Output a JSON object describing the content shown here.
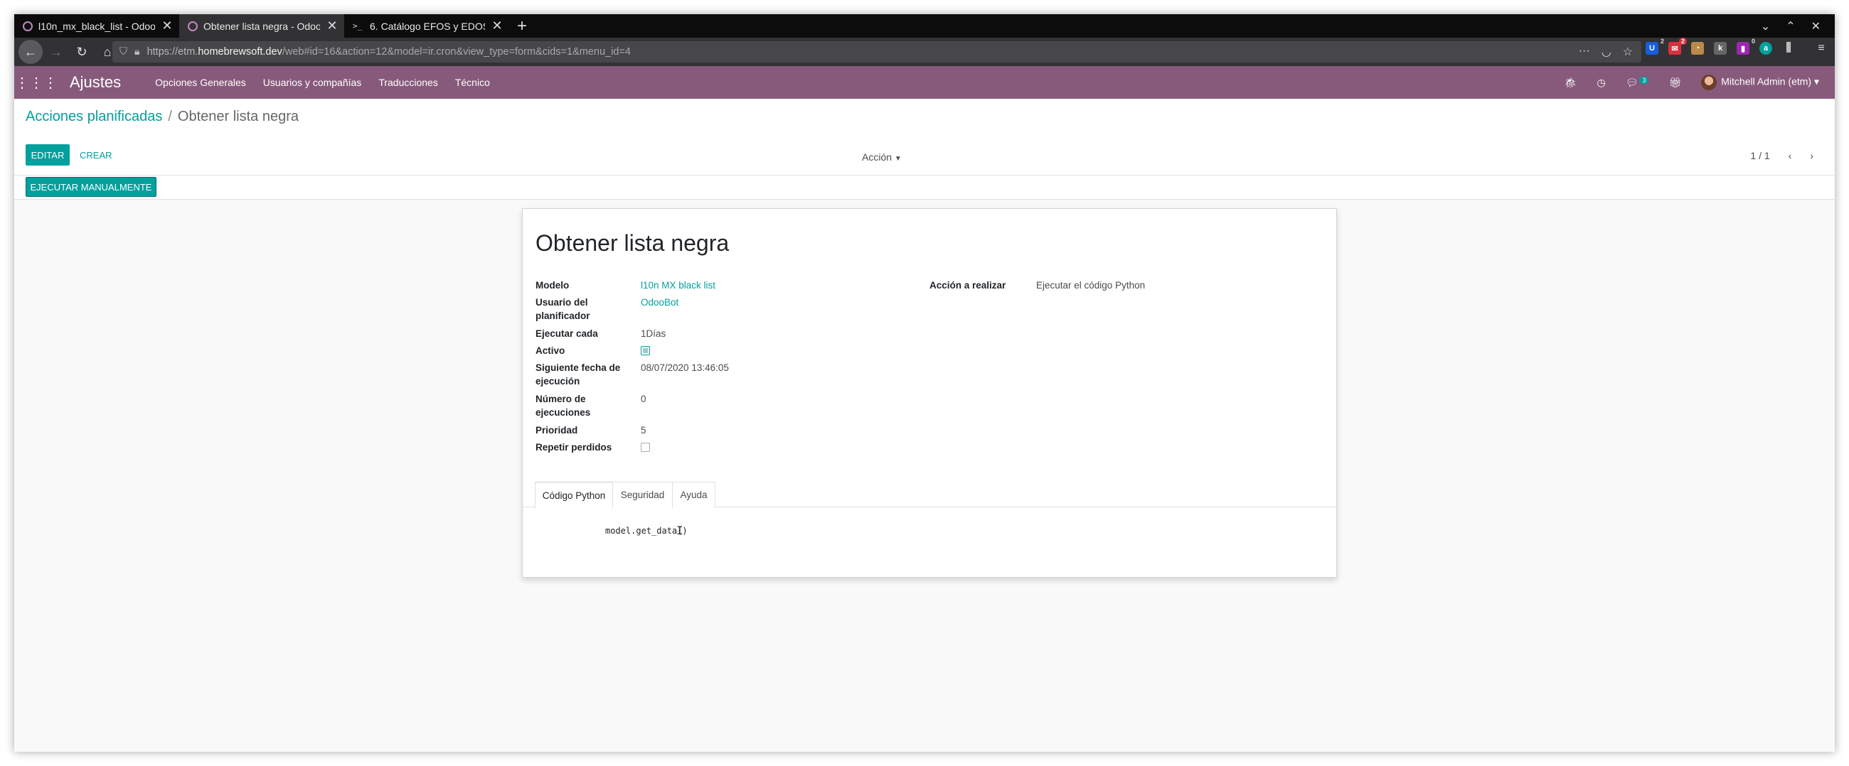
{
  "browser": {
    "tabs": [
      {
        "title": "l10n_mx_black_list - Odoo",
        "active": false,
        "icon": "odoo-favicon-icon"
      },
      {
        "title": "Obtener lista negra - Odoo",
        "active": true,
        "icon": "odoo-favicon-icon"
      },
      {
        "title": "6. Catálogo EFOS y EDOS",
        "active": false,
        "icon": "terminal-icon"
      }
    ],
    "url_prefix": "https://etm.",
    "url_host": "homebrewsoft.dev",
    "url_rest": "/web#id=16&action=12&model=ir.cron&view_type=form&cids=1&menu_id=4",
    "extension_badges": {
      "bitwarden": "2",
      "mail": "2",
      "ext_purple": "0"
    }
  },
  "topbar": {
    "app_name": "Ajustes",
    "menu": [
      "Opciones Generales",
      "Usuarios y compañías",
      "Traducciones",
      "Técnico"
    ],
    "chat_count": "3",
    "user": "Mitchell Admin (etm)",
    "color": "#875a7b"
  },
  "control_panel": {
    "breadcrumb_parent": "Acciones planificadas",
    "breadcrumb_sep": "/",
    "breadcrumb_current": "Obtener lista negra",
    "edit_label": "EDITAR",
    "create_label": "CREAR",
    "action_label": "Acción",
    "pager": "1 / 1"
  },
  "statusbar": {
    "run_manually_label": "EJECUTAR MANUALMENTE"
  },
  "form": {
    "title": "Obtener lista negra",
    "fields_left": [
      {
        "label": "Modelo",
        "value": "l10n MX black list"
      },
      {
        "label": "Usuario del planificador",
        "value": "OdooBot"
      },
      {
        "label": "Ejecutar cada",
        "value": "1Días"
      },
      {
        "label": "Activo",
        "value": true
      },
      {
        "label": "Siguiente fecha de ejecución",
        "value": "08/07/2020 13:46:05"
      },
      {
        "label": "Número de ejecuciones",
        "value": "0"
      },
      {
        "label": "Prioridad",
        "value": "5"
      },
      {
        "label": "Repetir perdidos",
        "value": false
      }
    ],
    "action_label": "Acción a realizar",
    "action_value": "Ejecutar el código Python",
    "tabs": [
      "Código Python",
      "Seguridad",
      "Ayuda"
    ],
    "code": "model.get_data()",
    "accent": "#00a09d"
  }
}
